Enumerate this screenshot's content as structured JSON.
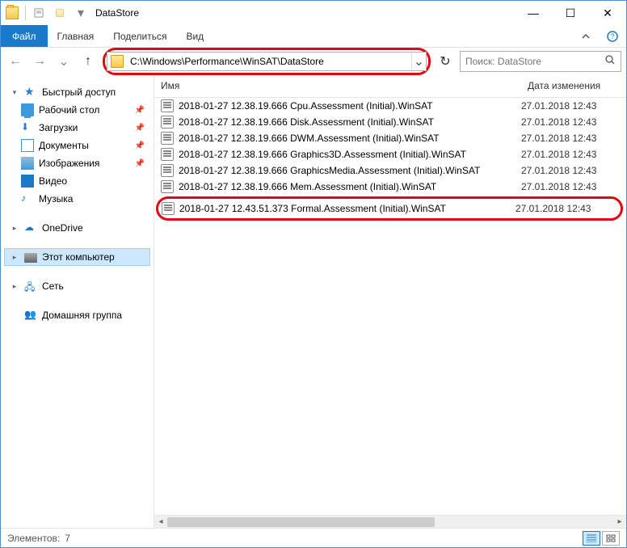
{
  "titlebar": {
    "title": "DataStore"
  },
  "win": {
    "minimize": "—",
    "maximize": "☐",
    "close": "✕"
  },
  "menu": {
    "file": "Файл",
    "items": [
      "Главная",
      "Поделиться",
      "Вид"
    ]
  },
  "nav": {
    "back": "←",
    "forward": "→",
    "dropdown": "⌄",
    "up": "↑",
    "address": "C:\\Windows\\Performance\\WinSAT\\DataStore",
    "refresh": "↻"
  },
  "search": {
    "placeholder": "Поиск: DataStore"
  },
  "columns": {
    "name": "Имя",
    "date": "Дата изменения"
  },
  "sidebar": {
    "quick": {
      "label": "Быстрый доступ",
      "items": [
        {
          "label": "Рабочий стол"
        },
        {
          "label": "Загрузки"
        },
        {
          "label": "Документы"
        },
        {
          "label": "Изображения"
        },
        {
          "label": "Видео"
        },
        {
          "label": "Музыка"
        }
      ]
    },
    "onedrive": "OneDrive",
    "thispc": "Этот компьютер",
    "network": "Сеть",
    "homegroup": "Домашняя группа"
  },
  "files": {
    "items": [
      {
        "name": "2018-01-27 12.38.19.666 Cpu.Assessment (Initial).WinSAT",
        "date": "27.01.2018 12:43"
      },
      {
        "name": "2018-01-27 12.38.19.666 Disk.Assessment (Initial).WinSAT",
        "date": "27.01.2018 12:43"
      },
      {
        "name": "2018-01-27 12.38.19.666 DWM.Assessment (Initial).WinSAT",
        "date": "27.01.2018 12:43"
      },
      {
        "name": "2018-01-27 12.38.19.666 Graphics3D.Assessment (Initial).WinSAT",
        "date": "27.01.2018 12:43"
      },
      {
        "name": "2018-01-27 12.38.19.666 GraphicsMedia.Assessment (Initial).WinSAT",
        "date": "27.01.2018 12:43"
      },
      {
        "name": "2018-01-27 12.38.19.666 Mem.Assessment (Initial).WinSAT",
        "date": "27.01.2018 12:43"
      },
      {
        "name": "2018-01-27 12.43.51.373 Formal.Assessment (Initial).WinSAT",
        "date": "27.01.2018 12:43"
      }
    ]
  },
  "status": {
    "elements_label": "Элементов:",
    "count": "7"
  }
}
